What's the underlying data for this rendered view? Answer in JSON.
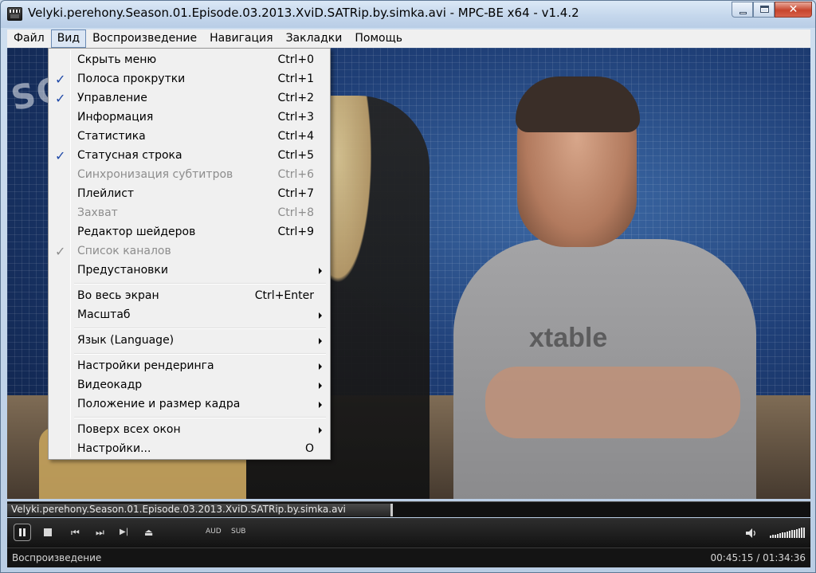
{
  "window": {
    "title": "Velyki.perehony.Season.01.Episode.03.2013.XviD.SATRip.by.simka.avi - MPC-BE x64 - v1.4.2",
    "close_glyph": "✕"
  },
  "menubar": [
    "Файл",
    "Вид",
    "Воспроизведение",
    "Навигация",
    "Закладки",
    "Помощь"
  ],
  "active_menu": "Вид",
  "view_menu": {
    "items": [
      {
        "label": "Скрыть меню",
        "shortcut": "Ctrl+0",
        "checked": false,
        "disabled": false,
        "submenu": false
      },
      {
        "label": "Полоса прокрутки",
        "shortcut": "Ctrl+1",
        "checked": true,
        "disabled": false,
        "submenu": false
      },
      {
        "label": "Управление",
        "shortcut": "Ctrl+2",
        "checked": true,
        "disabled": false,
        "submenu": false
      },
      {
        "label": "Информация",
        "shortcut": "Ctrl+3",
        "checked": false,
        "disabled": false,
        "submenu": false
      },
      {
        "label": "Статистика",
        "shortcut": "Ctrl+4",
        "checked": false,
        "disabled": false,
        "submenu": false
      },
      {
        "label": "Статусная строка",
        "shortcut": "Ctrl+5",
        "checked": true,
        "disabled": false,
        "submenu": false
      },
      {
        "label": "Синхронизация субтитров",
        "shortcut": "Ctrl+6",
        "checked": false,
        "disabled": true,
        "submenu": false
      },
      {
        "label": "Плейлист",
        "shortcut": "Ctrl+7",
        "checked": false,
        "disabled": false,
        "submenu": false
      },
      {
        "label": "Захват",
        "shortcut": "Ctrl+8",
        "checked": false,
        "disabled": true,
        "submenu": false
      },
      {
        "label": "Редактор шейдеров",
        "shortcut": "Ctrl+9",
        "checked": false,
        "disabled": false,
        "submenu": false
      },
      {
        "label": "Список каналов",
        "shortcut": "",
        "checked": true,
        "disabled": true,
        "submenu": false
      },
      {
        "label": "Предустановки",
        "shortcut": "",
        "checked": false,
        "disabled": false,
        "submenu": true
      },
      {
        "separator": true
      },
      {
        "label": "Во весь экран",
        "shortcut": "Ctrl+Enter",
        "checked": false,
        "disabled": false,
        "submenu": false
      },
      {
        "label": "Масштаб",
        "shortcut": "",
        "checked": false,
        "disabled": false,
        "submenu": true
      },
      {
        "separator": true
      },
      {
        "label": "Язык (Language)",
        "shortcut": "",
        "checked": false,
        "disabled": false,
        "submenu": true
      },
      {
        "separator": true
      },
      {
        "label": "Настройки рендеринга",
        "shortcut": "",
        "checked": false,
        "disabled": false,
        "submenu": true
      },
      {
        "label": "Видеокадр",
        "shortcut": "",
        "checked": false,
        "disabled": false,
        "submenu": true
      },
      {
        "label": "Положение и размер кадра",
        "shortcut": "",
        "checked": false,
        "disabled": false,
        "submenu": true
      },
      {
        "separator": true
      },
      {
        "label": "Поверх всех окон",
        "shortcut": "",
        "checked": false,
        "disabled": false,
        "submenu": true
      },
      {
        "label": "Настройки...",
        "shortcut": "O",
        "checked": false,
        "disabled": false,
        "submenu": false
      }
    ]
  },
  "video": {
    "watermark": "SOFTPORTAL",
    "shirt_text": "xtable"
  },
  "seekbar": {
    "filename": "Velyki.perehony.Season.01.Episode.03.2013.XviD.SATRip.by.simka.avi",
    "position_fraction": 0.48
  },
  "toolbar": {
    "aud_label": "AUD",
    "sub_label": "SUB",
    "volume_fraction": 1.0,
    "prev_glyph": "⏮",
    "next_glyph": "⏭",
    "step_glyph": "▶|",
    "eject_glyph": "⏏",
    "speaker_glyph": "🔈",
    "icons": [
      "pause-icon",
      "stop-icon",
      "previous-icon",
      "next-icon",
      "frame-step-icon",
      "eject-icon",
      "speaker-icon",
      "volume-bar"
    ]
  },
  "statusbar": {
    "state": "Воспроизведение",
    "time": "00:45:15 / 01:34:36"
  },
  "colors": {
    "check_color": "#1f49a8",
    "disabled_text": "#8d8d8d",
    "menu_bg": "#f0f0f0"
  }
}
